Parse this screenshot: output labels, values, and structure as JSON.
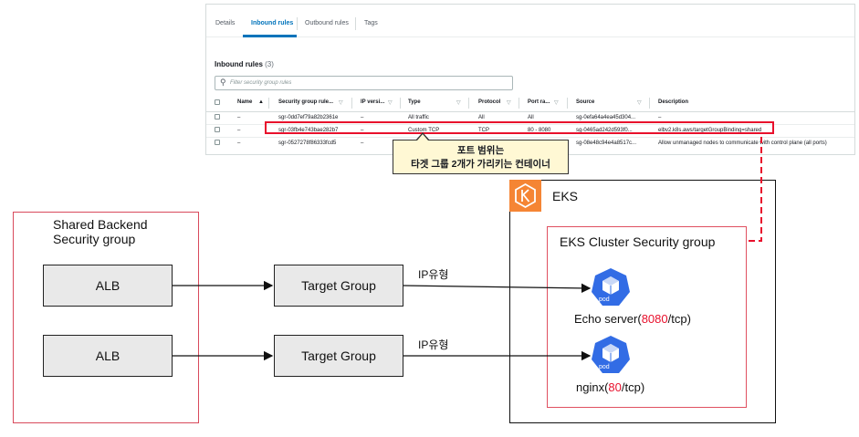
{
  "console": {
    "tabs": [
      "Details",
      "Inbound rules",
      "Outbound rules",
      "Tags"
    ],
    "section_title": "Inbound rules",
    "section_count": "(3)",
    "search_placeholder": "Filter security group rules",
    "columns": [
      "Name",
      "Security group rule...",
      "IP versi...",
      "Type",
      "Protocol",
      "Port ra...",
      "Source",
      "Description"
    ],
    "rows": [
      [
        "–",
        "sgr-0dd7ef79a82b2361e",
        "–",
        "All traffic",
        "All",
        "All",
        "sg-0efa64a4ea45d304...",
        "–"
      ],
      [
        "–",
        "sgr-03fb4e743bae282b7",
        "–",
        "Custom TCP",
        "TCP",
        "80 - 8080",
        "sg-0465ad242d593f0...",
        "elbv2.k8s.aws/targetGroupBinding=shared"
      ],
      [
        "–",
        "sgr-0527278f86333fcd5",
        "–",
        "",
        "",
        "",
        "sg-08e48c94e4a8517c...",
        "Allow unmanaged nodes to communicate with control plane (all ports)"
      ]
    ]
  },
  "callout": {
    "line1": "포트 범위는",
    "line2": "타겟 그룹 2개가 가리키는 컨테이너"
  },
  "diagram": {
    "shared_sg_label_line1": "Shared Backend",
    "shared_sg_label_line2": "Security group",
    "alb_1": "ALB",
    "alb_2": "ALB",
    "tg_1": "Target Group",
    "tg_2": "Target Group",
    "ip_label_1": "IP유형",
    "ip_label_2": "IP유형",
    "eks_label": "EKS",
    "eks_sg_label": "EKS Cluster Security group",
    "pod_icon_text": "pod",
    "pod_1_name": "Echo server(",
    "pod_1_port": "8080",
    "pod_1_suffix": "/tcp)",
    "pod_2_name": "nginx(",
    "pod_2_port": "80",
    "pod_2_suffix": "/tcp)"
  },
  "colors": {
    "highlight_red": "#e8102c",
    "eks_orange": "#f58534",
    "pod_blue": "#326ce5",
    "callout_bg": "#fff8d4"
  }
}
